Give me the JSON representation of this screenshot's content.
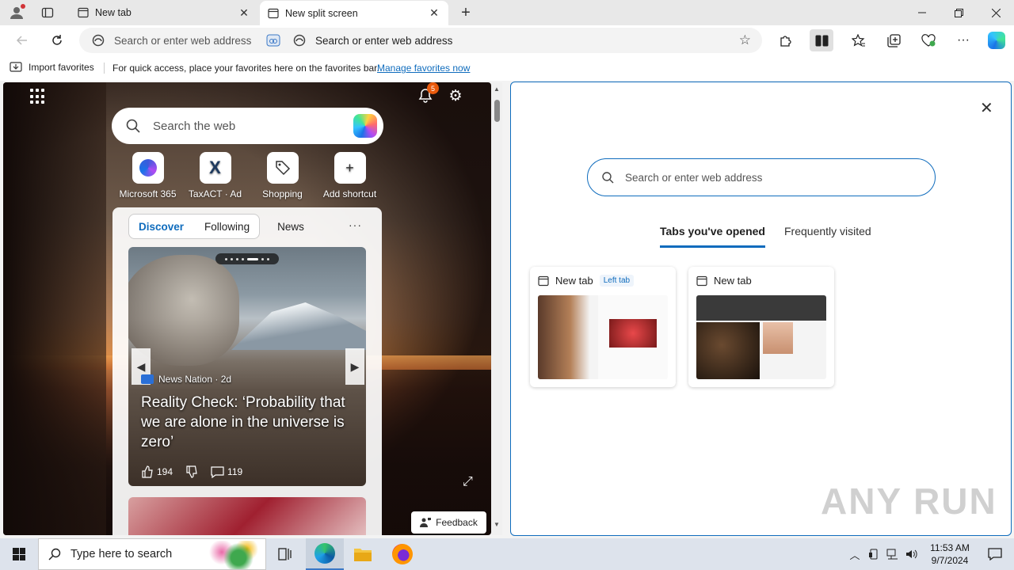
{
  "browser": {
    "tabs": [
      {
        "title": "New tab",
        "active": false
      },
      {
        "title": "New split screen",
        "active": true
      }
    ],
    "address_left_placeholder": "Search or enter web address",
    "address_right_placeholder": "Search or enter web address"
  },
  "favorites_bar": {
    "import_label": "Import favorites",
    "message": "For quick access, place your favorites here on the favorites bar.",
    "manage_link": "Manage favorites now"
  },
  "left_pane": {
    "notification_count": "5",
    "search_placeholder": "Search the web",
    "shortcuts": [
      {
        "label": "Microsoft 365"
      },
      {
        "label": "TaxACT · Ad"
      },
      {
        "label": "Shopping"
      },
      {
        "label": "Add shortcut"
      }
    ],
    "feed_tabs": {
      "discover": "Discover",
      "following": "Following",
      "news": "News",
      "more": "···"
    },
    "card": {
      "source": "News Nation · 2d",
      "headline": "Reality Check: ‘Probability that we are alone in the universe is zero’",
      "likes": "194",
      "comments": "119"
    },
    "feedback_label": "Feedback"
  },
  "right_pane": {
    "search_placeholder": "Search or enter web address",
    "tabs": {
      "opened": "Tabs you've opened",
      "frequent": "Frequently visited"
    },
    "cards": [
      {
        "title": "New tab",
        "tag": "Left tab"
      },
      {
        "title": "New tab",
        "tag": ""
      }
    ]
  },
  "watermark": "ANY RUN",
  "taskbar": {
    "search_placeholder": "Type here to search",
    "time": "11:53 AM",
    "date": "9/7/2024"
  },
  "colors": {
    "accent": "#0f6cbd",
    "badge": "#e8590c"
  }
}
